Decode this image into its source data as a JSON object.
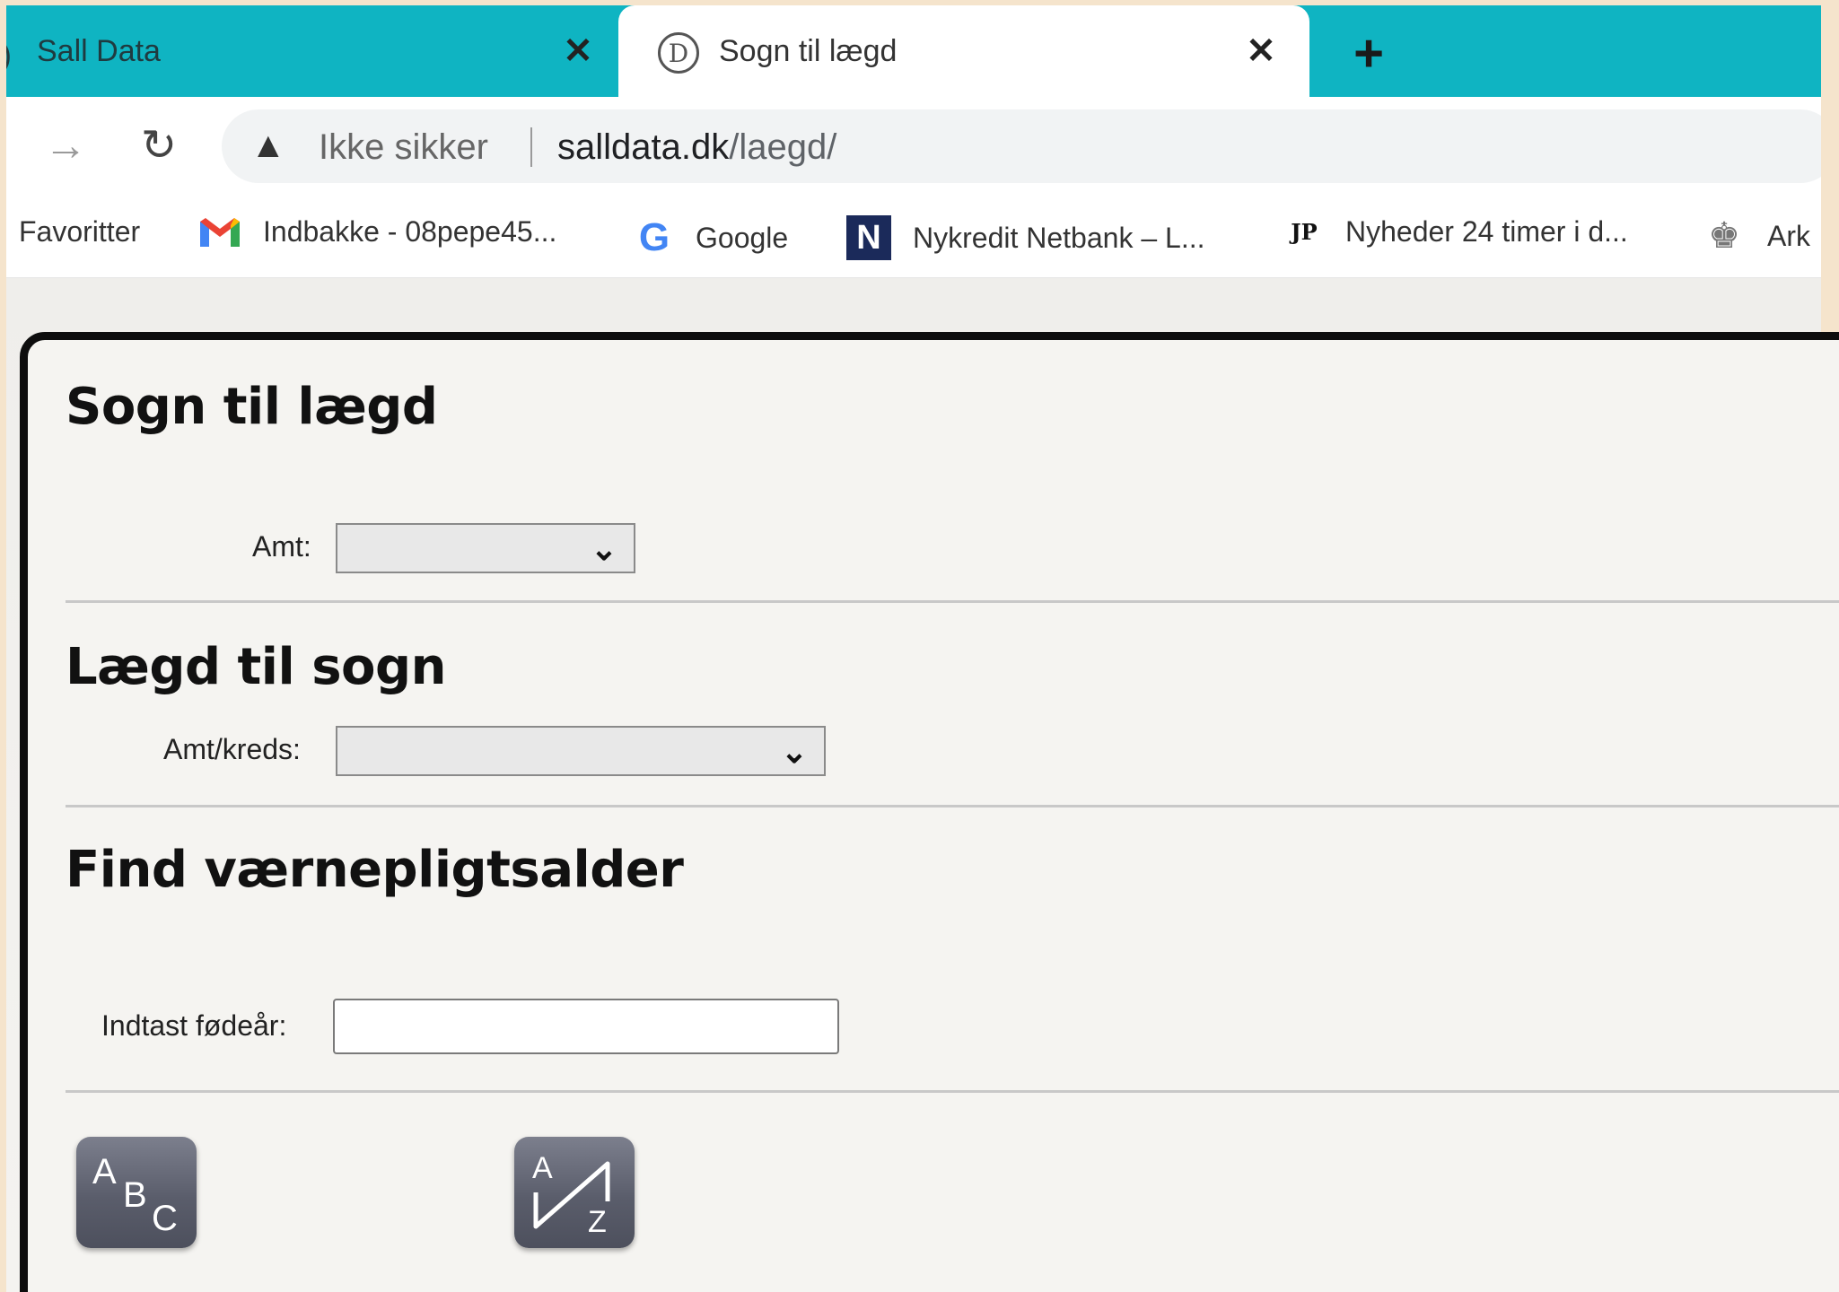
{
  "tabs": [
    {
      "title": "Sall Data",
      "active": false
    },
    {
      "title": "Sogn til lægd",
      "active": true
    }
  ],
  "toolbar": {
    "security_label": "Ikke sikker",
    "url_host": "salldata.dk",
    "url_path": "/laegd/"
  },
  "bookmarks": [
    {
      "label": "Favoritter",
      "icon": "none"
    },
    {
      "label": "Indbakke - 08pepe45...",
      "icon": "gmail-icon"
    },
    {
      "label": "Google",
      "icon": "google-icon"
    },
    {
      "label": "Nykredit Netbank – L...",
      "icon": "nykredit-icon"
    },
    {
      "label": "Nyheder 24 timer i d...",
      "icon": "jp-icon"
    },
    {
      "label": "Ark",
      "icon": "crown-icon"
    }
  ],
  "icons": {
    "gmail": "M",
    "google": "G",
    "nykredit": "N",
    "jp": "JP"
  },
  "sections": {
    "sogn_til_laegd": {
      "title": "Sogn til lægd",
      "amt_label": "Amt:",
      "amt_value": ""
    },
    "laegd_til_sogn": {
      "title": "Lægd til sogn",
      "amt_kreds_label": "Amt/kreds:",
      "amt_kreds_value": ""
    },
    "vaernepligt": {
      "title": "Find værnepligtsalder",
      "input_label": "Indtast fødeår:",
      "input_value": ""
    }
  },
  "sort_buttons": [
    {
      "name": "abc-sort-icon",
      "glyphs": [
        "A",
        "B",
        "C"
      ]
    },
    {
      "name": "az-sort-icon",
      "glyphs": [
        "A",
        "Z"
      ]
    }
  ]
}
